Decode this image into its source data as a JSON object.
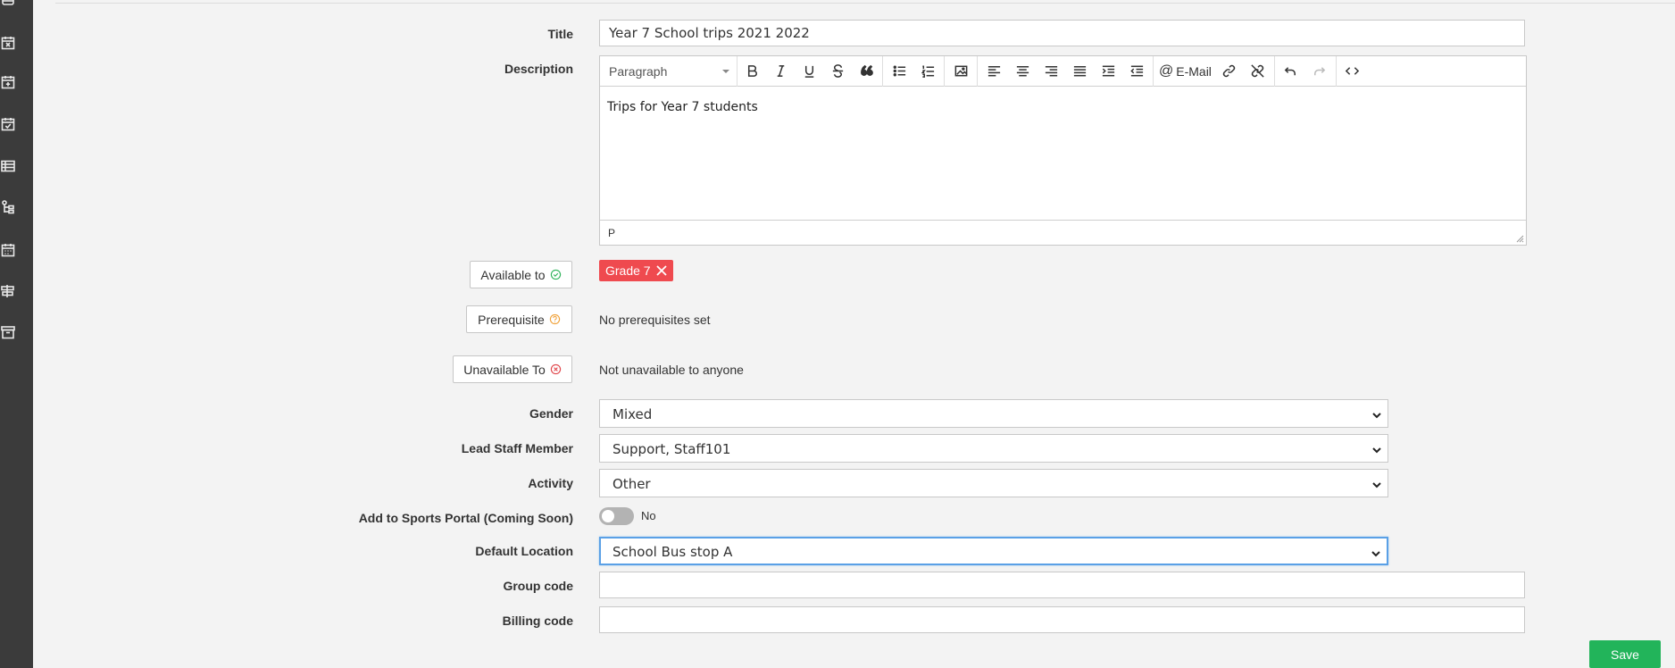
{
  "sidebar": {
    "icons": [
      "bus-icon",
      "calendar-x-icon",
      "calendar-plus-icon",
      "calendar-check-icon",
      "table-icon",
      "user-hierarchy-icon",
      "calendar-grid-icon",
      "signpost-icon",
      "archive-icon"
    ]
  },
  "form": {
    "title_label": "Title",
    "title_value": "Year 7 School trips 2021 2022",
    "description_label": "Description",
    "editor": {
      "format": "Paragraph",
      "email_label": "E-Mail",
      "body": "Trips for Year 7 students",
      "status": "P"
    },
    "available_to_button": "Available to",
    "available_tag": "Grade 7",
    "prerequisite_button": "Prerequisite",
    "prerequisite_text": "No prerequisites set",
    "unavailable_button": "Unavailable To",
    "unavailable_text": "Not unavailable to anyone",
    "gender_label": "Gender",
    "gender_value": "Mixed",
    "lead_label": "Lead Staff Member",
    "lead_value": "Support, Staff101",
    "activity_label": "Activity",
    "activity_value": "Other",
    "sports_label": "Add to Sports Portal (Coming Soon)",
    "sports_value": "No",
    "location_label": "Default Location",
    "location_value": "School Bus stop A",
    "group_label": "Group code",
    "group_value": "",
    "billing_label": "Billing code",
    "billing_value": "",
    "save_label": "Save"
  },
  "colors": {
    "sidebar": "#3b3b3b",
    "tag": "#ef4a4f",
    "save": "#22b45a",
    "available_icon": "#2fb35a",
    "prerequisite_icon": "#f0a23a",
    "unavailable_icon": "#e0454a"
  }
}
